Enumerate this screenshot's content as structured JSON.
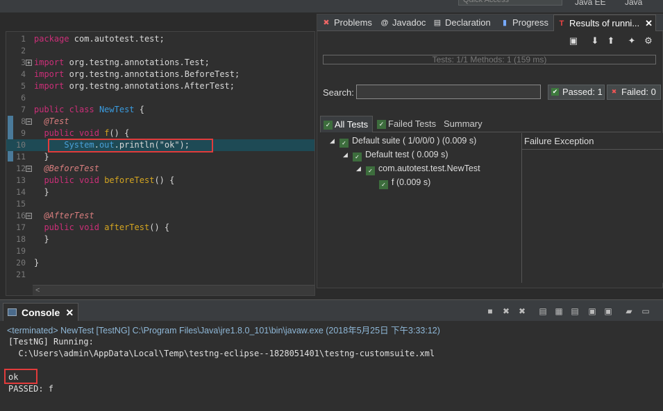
{
  "window": {
    "quick_access_placeholder": "Quick Access",
    "perspectives": [
      "Java EE",
      "Java"
    ]
  },
  "editor": {
    "lines": [
      {
        "n": "1",
        "fold": "",
        "parts": [
          [
            "kw",
            "package"
          ],
          [
            "plain",
            " com.autotest.test;"
          ]
        ]
      },
      {
        "n": "2",
        "fold": "",
        "parts": []
      },
      {
        "n": "3",
        "fold": "⊕",
        "parts": [
          [
            "kw",
            "import"
          ],
          [
            "plain",
            " org.testng.annotations.Test;"
          ]
        ]
      },
      {
        "n": "4",
        "fold": "",
        "parts": [
          [
            "kw",
            "import"
          ],
          [
            "plain",
            " org.testng.annotations.BeforeTest;"
          ]
        ]
      },
      {
        "n": "5",
        "fold": "",
        "parts": [
          [
            "kw",
            "import"
          ],
          [
            "plain",
            " org.testng.annotations.AfterTest;"
          ]
        ]
      },
      {
        "n": "6",
        "fold": "",
        "parts": []
      },
      {
        "n": "7",
        "fold": "",
        "parts": [
          [
            "kw",
            "public"
          ],
          [
            "plain",
            " "
          ],
          [
            "kw",
            "class"
          ],
          [
            "plain",
            " "
          ],
          [
            "cls",
            "NewTest"
          ],
          [
            "plain",
            " {"
          ]
        ]
      },
      {
        "n": "8",
        "fold": "⊖",
        "parts": [
          [
            "plain",
            "  "
          ],
          [
            "ann",
            "@Test"
          ]
        ]
      },
      {
        "n": "9",
        "fold": "",
        "parts": [
          [
            "plain",
            "  "
          ],
          [
            "kw",
            "public"
          ],
          [
            "plain",
            " "
          ],
          [
            "kw",
            "void"
          ],
          [
            "plain",
            " "
          ],
          [
            "meth",
            "f"
          ],
          [
            "plain",
            "() {"
          ]
        ]
      },
      {
        "n": "10",
        "fold": "",
        "parts": [
          [
            "plain",
            "      "
          ],
          [
            "sysout",
            "System"
          ],
          [
            "plain",
            "."
          ],
          [
            "sysout",
            "out"
          ],
          [
            "plain",
            ".println(\"ok\");"
          ]
        ]
      },
      {
        "n": "11",
        "fold": "",
        "parts": [
          [
            "plain",
            "  }"
          ]
        ]
      },
      {
        "n": "12",
        "fold": "⊖",
        "parts": [
          [
            "plain",
            "  "
          ],
          [
            "ann",
            "@BeforeTest"
          ]
        ]
      },
      {
        "n": "13",
        "fold": "",
        "parts": [
          [
            "plain",
            "  "
          ],
          [
            "kw",
            "public"
          ],
          [
            "plain",
            " "
          ],
          [
            "kw",
            "void"
          ],
          [
            "plain",
            " "
          ],
          [
            "meth",
            "beforeTest"
          ],
          [
            "plain",
            "() {"
          ]
        ]
      },
      {
        "n": "14",
        "fold": "",
        "parts": [
          [
            "plain",
            "  }"
          ]
        ]
      },
      {
        "n": "15",
        "fold": "",
        "parts": []
      },
      {
        "n": "16",
        "fold": "⊖",
        "parts": [
          [
            "plain",
            "  "
          ],
          [
            "ann",
            "@AfterTest"
          ]
        ]
      },
      {
        "n": "17",
        "fold": "",
        "parts": [
          [
            "plain",
            "  "
          ],
          [
            "kw",
            "public"
          ],
          [
            "plain",
            " "
          ],
          [
            "kw",
            "void"
          ],
          [
            "plain",
            " "
          ],
          [
            "meth",
            "afterTest"
          ],
          [
            "plain",
            "() {"
          ]
        ]
      },
      {
        "n": "18",
        "fold": "",
        "parts": [
          [
            "plain",
            "  }"
          ]
        ]
      },
      {
        "n": "19",
        "fold": "",
        "parts": []
      },
      {
        "n": "20",
        "fold": "",
        "parts": [
          [
            "plain",
            "}"
          ]
        ]
      },
      {
        "n": "21",
        "fold": "",
        "parts": []
      }
    ],
    "scroll_left_glyph": "<"
  },
  "results": {
    "tabs": [
      {
        "label": "Problems",
        "icon": "problems-icon"
      },
      {
        "label": "Javadoc",
        "icon": "javadoc-icon"
      },
      {
        "label": "Declaration",
        "icon": "declaration-icon"
      },
      {
        "label": "Progress",
        "icon": "progress-icon"
      },
      {
        "label": "Results of runni...",
        "icon": "testng-icon"
      }
    ],
    "progress_text": "Tests: 1/1  Methods: 1 (159 ms)",
    "progress_fraction": 1.0,
    "search_label": "Search:",
    "search_value": "",
    "passed_label": "Passed: 1",
    "failed_label": "Failed: 0",
    "subtabs": [
      "All Tests",
      "Failed Tests",
      "Summary"
    ],
    "tree": [
      {
        "label": "Default suite ( 1/0/0/0 ) (0.009 s)",
        "depth": 0
      },
      {
        "label": "Default test ( 0.009 s)",
        "depth": 1
      },
      {
        "label": "com.autotest.test.NewTest",
        "depth": 2
      },
      {
        "label": "f  (0.009 s)",
        "depth": 3
      }
    ],
    "failure_header": "Failure Exception"
  },
  "console": {
    "tab_label": "Console",
    "terminated_line": "<terminated> NewTest [TestNG] C:\\Program Files\\Java\\jre1.8.0_101\\bin\\javaw.exe (2018年5月25日 下午3:33:12)",
    "output": [
      "[TestNG] Running:",
      "  C:\\Users\\admin\\AppData\\Local\\Temp\\testng-eclipse--1828051401\\testng-customsuite.xml",
      "",
      "ok",
      "PASSED: f",
      "",
      "==============================================="
    ]
  },
  "colors": {
    "highlight_box": "#e23b3b",
    "keyword": "#cc2f78",
    "annotation": "#d97e7e",
    "class_name": "#3a9ce0",
    "method_name": "#d4a520"
  }
}
